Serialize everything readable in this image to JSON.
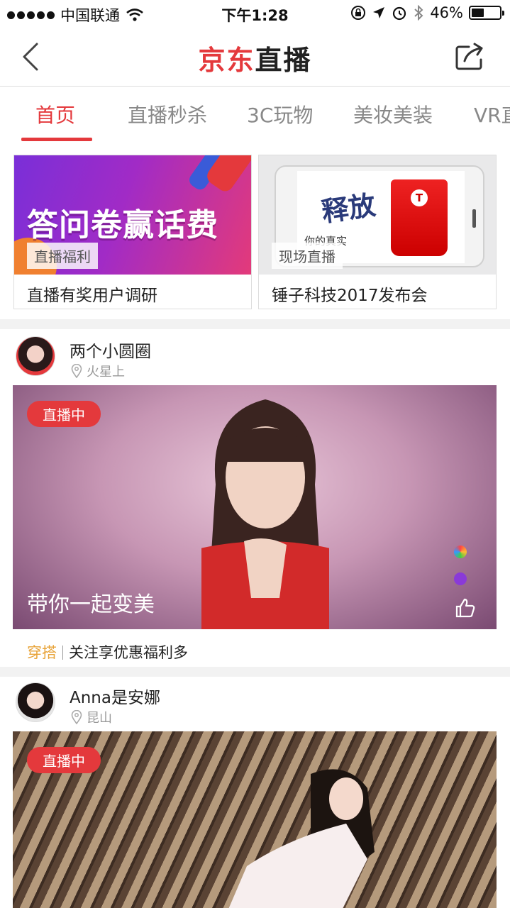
{
  "status_bar": {
    "carrier": "中国联通",
    "time": "下午1:28",
    "battery": "46%",
    "battery_level": 0.46
  },
  "nav": {
    "title_brand": "京东",
    "title_rest": "直播"
  },
  "tabs": [
    {
      "label": "首页",
      "active": true
    },
    {
      "label": "直播秒杀",
      "active": false
    },
    {
      "label": "3C玩物",
      "active": false
    },
    {
      "label": "美妆美装",
      "active": false
    },
    {
      "label": "VR直",
      "active": false
    }
  ],
  "features": [
    {
      "banner_text": "答问卷赢话费",
      "tag": "直播福利",
      "caption": "直播有奖用户调研"
    },
    {
      "banner_text": "释放",
      "banner_sub": "你的真实",
      "tag": "现场直播",
      "caption": "锤子科技2017发布会"
    }
  ],
  "posts": [
    {
      "host": "两个小圆圈",
      "location": "火星上",
      "badge": "直播中",
      "cover_title": "带你一起变美",
      "category": "穿搭",
      "description": "关注享优惠福利多"
    },
    {
      "host": "Anna是安娜",
      "location": "昆山",
      "badge": "直播中"
    }
  ],
  "colors": {
    "accent": "#e4393c",
    "category": "#e8a43a"
  }
}
